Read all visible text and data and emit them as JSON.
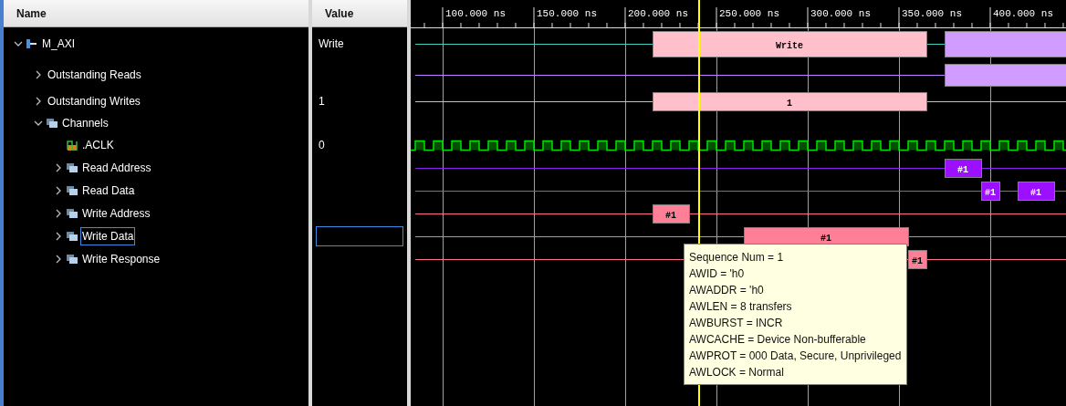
{
  "columns": {
    "name": "Name",
    "value": "Value"
  },
  "ruler": {
    "ticks": [
      {
        "label": "100.000 ns"
      },
      {
        "label": "150.000 ns"
      },
      {
        "label": "200.000 ns"
      },
      {
        "label": "250.000 ns"
      },
      {
        "label": "300.000 ns"
      },
      {
        "label": "350.000 ns"
      },
      {
        "label": "400.000 ns"
      }
    ]
  },
  "signals": [
    {
      "name": "M_AXI",
      "kind": "bus",
      "value": "Write",
      "expanded": true,
      "selected": false,
      "color": "#40d0c0",
      "bars": [
        {
          "label": "Write",
          "color": "#ffc0cb"
        },
        {
          "color": "#d09cff"
        }
      ],
      "children": [
        {
          "name": "Outstanding Reads",
          "kind": "counter",
          "expanded": false,
          "selected": false,
          "color": "#c080ff",
          "bars": [
            {
              "color": "#d09cff"
            }
          ]
        },
        {
          "name": "Outstanding Writes",
          "kind": "counter",
          "value": "1",
          "expanded": false,
          "selected": false,
          "color": "#ffa8b0",
          "bars": [
            {
              "label": "1",
              "color": "#ffc0cb"
            }
          ]
        },
        {
          "name": "Channels",
          "kind": "group",
          "expanded": true,
          "selected": false,
          "children": [
            {
              "name": ".ACLK",
              "kind": "clock",
              "value": "0",
              "selected": false,
              "color": "#00e000"
            },
            {
              "name": "Read Address",
              "kind": "group",
              "expanded": false,
              "selected": false,
              "color": "#9020f0",
              "bars": [
                {
                  "label": "#1",
                  "color": "#9a10ff"
                }
              ]
            },
            {
              "name": "Read Data",
              "kind": "group",
              "expanded": false,
              "selected": false,
              "color": "#9a50d0",
              "bars": [
                {
                  "label": "#1",
                  "color": "#9a10ff"
                },
                {
                  "label": "#1",
                  "color": "#9a10ff"
                }
              ]
            },
            {
              "name": "Write Address",
              "kind": "group",
              "expanded": false,
              "selected": false,
              "color": "#ff7088",
              "bars": [
                {
                  "label": "#1",
                  "color": "#ff8096"
                }
              ]
            },
            {
              "name": "Write Data",
              "kind": "group",
              "expanded": false,
              "selected": true,
              "color": "#ff7088",
              "bars": [
                {
                  "label": "#1",
                  "color": "#ff8096"
                }
              ]
            },
            {
              "name": "Write Response",
              "kind": "group",
              "expanded": false,
              "selected": false,
              "color": "#ff7088",
              "bars": [
                {
                  "label": "#1",
                  "color": "#ff8096"
                }
              ]
            }
          ]
        }
      ]
    }
  ],
  "tooltip": {
    "lines": [
      "Sequence Num = 1",
      "AWID = 'h0",
      "AWADDR = 'h0",
      "AWLEN = 8 transfers",
      "AWBURST = INCR",
      "AWCACHE = Device Non-bufferable",
      "AWPROT = 000 Data, Secure, Unprivileged",
      "AWLOCK = Normal"
    ]
  }
}
